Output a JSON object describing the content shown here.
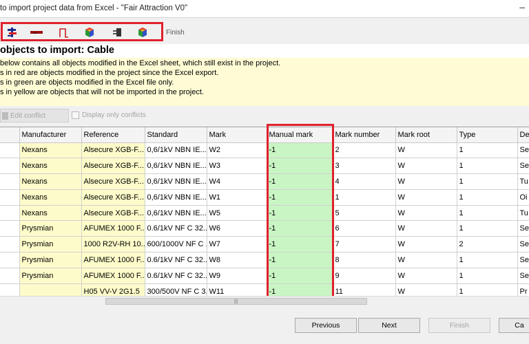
{
  "window": {
    "title": "to import project data from Excel - \"Fair Attraction V0\"",
    "minimize": "–"
  },
  "toolbar": {
    "finish_label": "Finish",
    "buttons": [
      "object-tree-icon",
      "cable-icon",
      "wire-icon",
      "colored-blocks-icon",
      "connector-icon",
      "colored-blocks-icon"
    ]
  },
  "heading": "objects to import: Cable",
  "info": {
    "lines": [
      "below contains all objects modified in the Excel sheet, which still exist in the project.",
      "s in red are objects modified in the project since the Excel export.",
      "s in green are objects modified in the Excel file only.",
      "s in yellow are objects that will not be imported in the project."
    ]
  },
  "actions": {
    "edit_conflict": "Edit conflict",
    "display_only_conflicts": "Display only conflicts"
  },
  "table": {
    "columns": [
      "",
      "Manufacturer",
      "Reference",
      "Standard",
      "Mark",
      "Manual mark",
      "Mark number",
      "Mark root",
      "Type",
      "De"
    ],
    "rows": [
      [
        "",
        "Nexans",
        "Alsecure XGB-F...",
        "0,6/1kV NBN IE...",
        "W2",
        "-1",
        "2",
        "W",
        "1",
        "Se"
      ],
      [
        "",
        "Nexans",
        "Alsecure XGB-F...",
        "0,6/1kV NBN IE...",
        "W3",
        "-1",
        "3",
        "W",
        "1",
        "Se"
      ],
      [
        "",
        "Nexans",
        "Alsecure XGB-F...",
        "0,6/1kV NBN IE...",
        "W4",
        "-1",
        "4",
        "W",
        "1",
        "Tu"
      ],
      [
        "",
        "Nexans",
        "Alsecure XGB-F...",
        "0,6/1kV NBN IE...",
        "W1",
        "-1",
        "1",
        "W",
        "1",
        "Oi"
      ],
      [
        "",
        "Nexans",
        "Alsecure XGB-F...",
        "0,6/1kV NBN IE...",
        "W5",
        "-1",
        "5",
        "W",
        "1",
        "Tu"
      ],
      [
        "",
        "Prysmian",
        "AFUMEX 1000 F...",
        "0.6/1kV NF C 32...",
        "W6",
        "-1",
        "6",
        "W",
        "1",
        "Se"
      ],
      [
        "",
        "Prysmian",
        "1000 R2V-RH 10...",
        "600/1000V NF C ...",
        "W7",
        "-1",
        "7",
        "W",
        "2",
        "Se"
      ],
      [
        "",
        "Prysmian",
        "AFUMEX 1000 F...",
        "0.6/1kV NF C 32...",
        "W8",
        "-1",
        "8",
        "W",
        "1",
        "Se"
      ],
      [
        "",
        "Prysmian",
        "AFUMEX 1000 F...",
        "0.6/1kV NF C 32...",
        "W9",
        "-1",
        "9",
        "W",
        "1",
        "Se"
      ],
      [
        "",
        "",
        "H05 VV-V 2G1.5",
        "300/500V NF C 3...",
        "W11",
        "-1",
        "11",
        "W",
        "1",
        "Pr"
      ]
    ]
  },
  "footer": {
    "previous": "Previous",
    "next": "Next",
    "finish": "Finish",
    "cancel": "Ca"
  }
}
